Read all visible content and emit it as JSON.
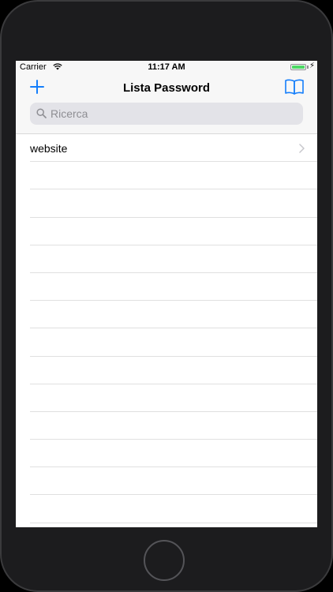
{
  "status_bar": {
    "carrier": "Carrier",
    "time": "11:17 AM",
    "battery_level": 1.0
  },
  "nav": {
    "title": "Lista Password",
    "left_icon": "plus-icon",
    "right_icon": "book-icon",
    "accent_color": "#147efb"
  },
  "search": {
    "placeholder": "Ricerca",
    "value": ""
  },
  "list": {
    "items": [
      {
        "label": "website"
      }
    ],
    "empty_rows": 13
  }
}
